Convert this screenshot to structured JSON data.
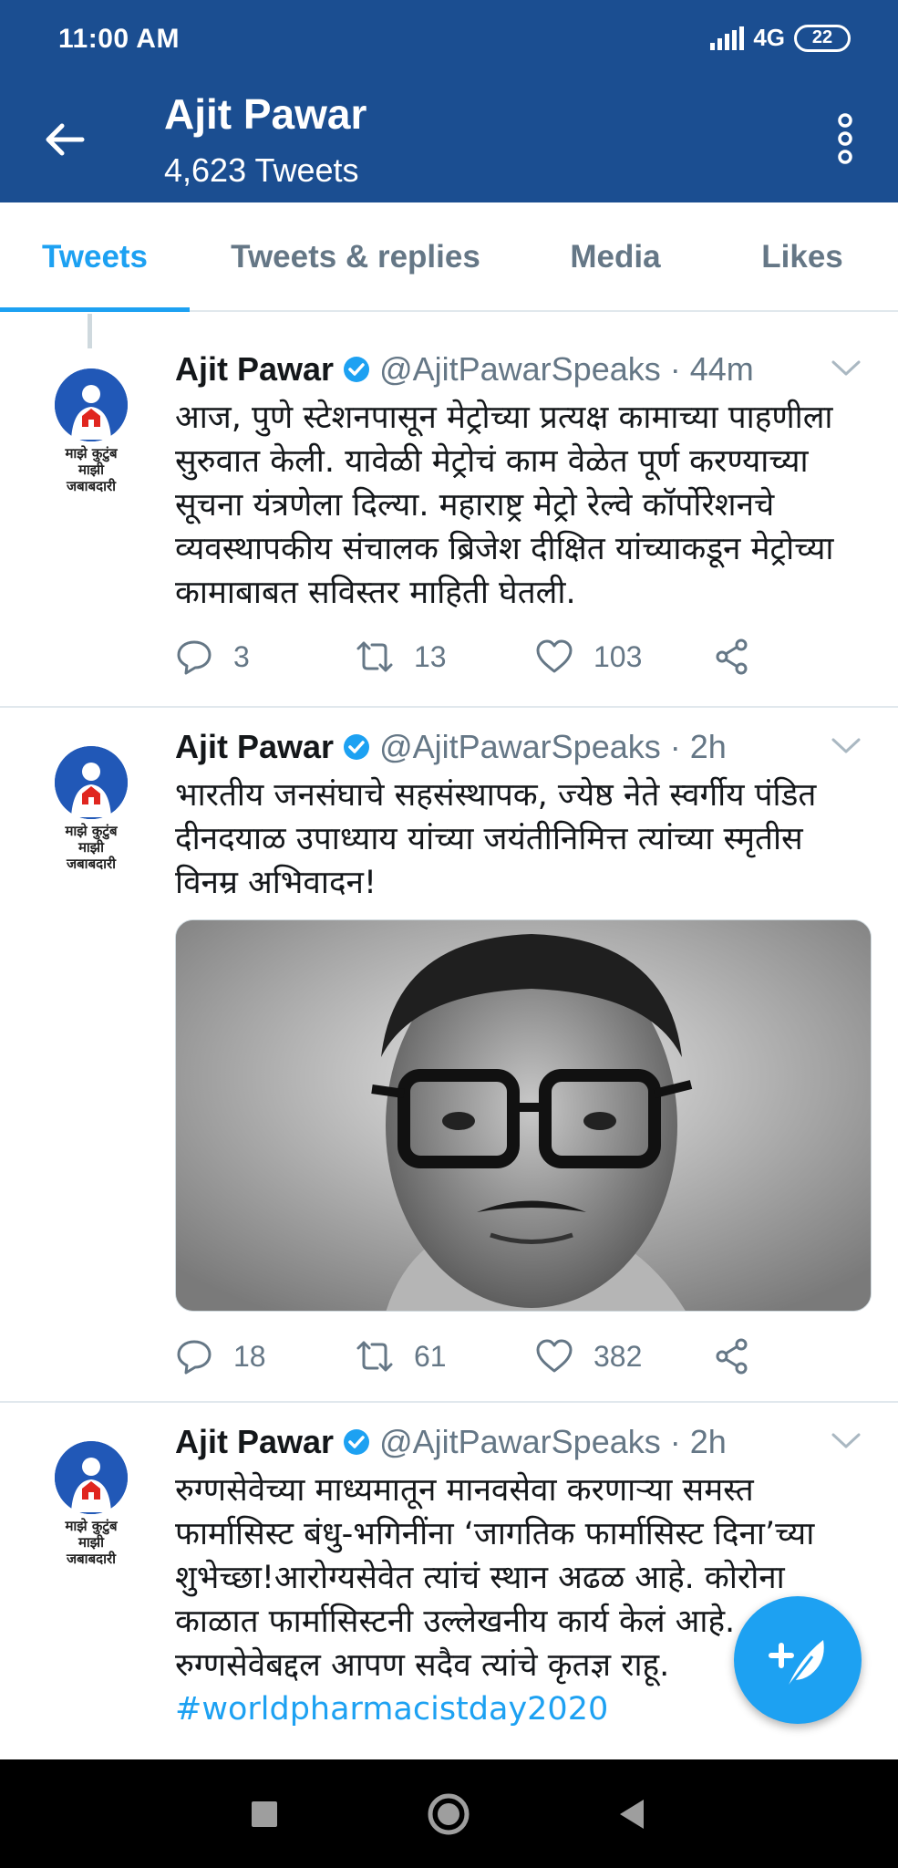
{
  "status_bar": {
    "time": "11:00 AM",
    "network": "4G",
    "battery": "22"
  },
  "header": {
    "title": "Ajit Pawar",
    "subtitle": "4,623 Tweets"
  },
  "tabs": [
    {
      "label": "Tweets",
      "active": true
    },
    {
      "label": "Tweets & replies",
      "active": false
    },
    {
      "label": "Media",
      "active": false
    },
    {
      "label": "Likes",
      "active": false
    }
  ],
  "avatar_caption": {
    "line1": "माझे कुटुंब",
    "line2": "माझी जबाबदारी"
  },
  "tweets": [
    {
      "name": "Ajit Pawar",
      "handle": "@AjitPawarSpeaks · 44m",
      "lines": [
        "आज, पुणे स्टेशनपासून मेट्रोच्या प्रत्यक्ष कामाच्या पाहणीला",
        "सुरुवात केली. यावेळी मेट्रोचं काम वेळेत पूर्ण करण्याच्या",
        "सूचना यंत्रणेला दिल्या. महाराष्ट्र मेट्रो रेल्वे कॉर्पोरेशनचे",
        "व्यवस्थापकीय संचालक ब्रिजेश दीक्षित यांच्याकडून मेट्रोच्या",
        "कामाबाबत सविस्तर माहिती घेतली."
      ],
      "replies": "3",
      "retweets": "13",
      "likes": "103"
    },
    {
      "name": "Ajit Pawar",
      "handle": "@AjitPawarSpeaks · 2h",
      "lines": [
        "भारतीय जनसंघाचे सहसंस्थापक, ज्येष्ठ नेते स्वर्गीय पंडित",
        "दीनदयाळ उपाध्याय यांच्या जयंतीनिमित्त त्यांच्या स्मृतीस",
        "विनम्र अभिवादन!"
      ],
      "replies": "18",
      "retweets": "61",
      "likes": "382"
    },
    {
      "name": "Ajit Pawar",
      "handle": "@AjitPawarSpeaks · 2h",
      "lines": [
        "रुग्णसेवेच्या माध्यमातून मानवसेवा करणाऱ्या समस्त",
        "फार्मासिस्ट बंधु-भगिनींना ‘जागतिक फार्मासिस्ट दिना’च्या",
        "शुभेच्छा!आरोग्यसेवेत त्यांचं स्थान अढळ आहे. कोरोना",
        "काळात फार्मासिस्टनी उल्लेखनीय कार्य केलं आहे.",
        "रुग्णसेवेबद्दल आपण सदैव त्यांचे कृतज्ञ राहू."
      ],
      "hashtag": "#worldpharmacistday2020"
    }
  ],
  "colors": {
    "header_bg": "#1b4e91",
    "accent": "#1da1f2",
    "muted": "#657786"
  }
}
